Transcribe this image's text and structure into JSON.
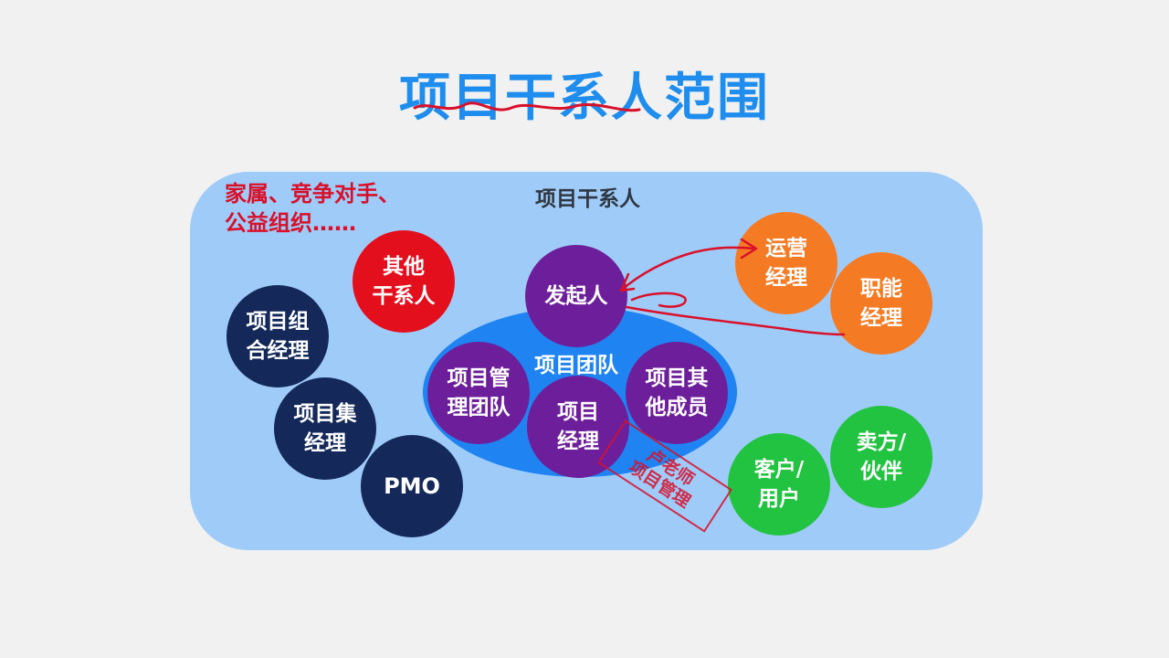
{
  "title": "项目干系人范围",
  "stakeholders_label": "项目干系人",
  "note": {
    "line1": "家属、竞争对手、",
    "line2": "公益组织……"
  },
  "team_label": "项目团队",
  "circles": {
    "other_stakeholders": {
      "line1": "其他",
      "line2": "干系人"
    },
    "portfolio_manager": {
      "line1": "项目组",
      "line2": "合经理"
    },
    "program_manager": {
      "line1": "项目集",
      "line2": "经理"
    },
    "pmo": {
      "line1": "PMO"
    },
    "sponsor": {
      "line1": "发起人"
    },
    "pm_team": {
      "line1": "项目管",
      "line2": "理团队"
    },
    "project_manager": {
      "line1": "项目",
      "line2": "经理"
    },
    "other_members": {
      "line1": "项目其",
      "line2": "他成员"
    },
    "operations_manager": {
      "line1": "运营",
      "line2": "经理"
    },
    "functional_manager": {
      "line1": "职能",
      "line2": "经理"
    },
    "customer": {
      "line1": "客户/",
      "line2": "用户"
    },
    "vendor": {
      "line1": "卖方/",
      "line2": "伙伴"
    }
  },
  "stamp": {
    "line1": "卢老师",
    "line2": "项目管理"
  },
  "colors": {
    "title": "#1f8ded",
    "panel": "#9fcbf8",
    "team": "#1f83f2",
    "navy": "#14295a",
    "red": "#e40f1d",
    "purple": "#6d1f9b",
    "orange": "#f47a24",
    "green": "#21c341",
    "annotation": "#d9102a"
  }
}
